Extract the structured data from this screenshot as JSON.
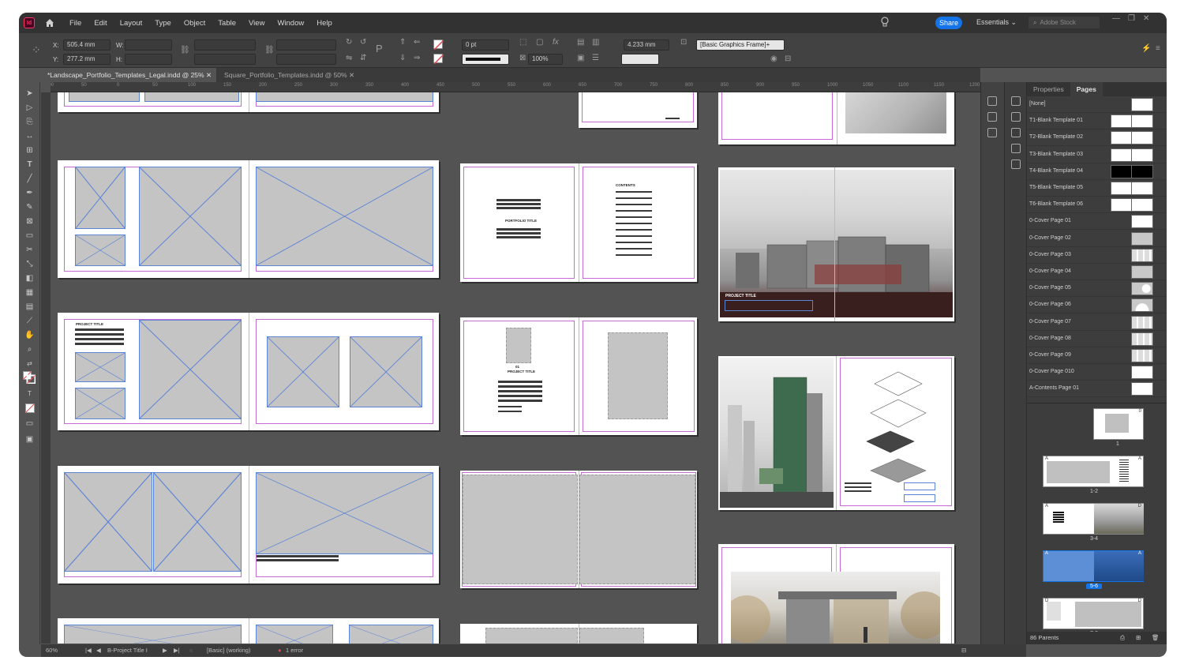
{
  "menu": {
    "items": [
      "File",
      "Edit",
      "Layout",
      "Type",
      "Object",
      "Table",
      "View",
      "Window",
      "Help"
    ],
    "share": "Share",
    "workspace": "Essentials",
    "stock_placeholder": "Adobe Stock"
  },
  "control": {
    "x_label": "X:",
    "x_value": "505.4 mm",
    "y_label": "Y:",
    "y_value": "277.2 mm",
    "w_label": "W:",
    "h_label": "H:",
    "stroke_weight": "0 pt",
    "opacity": "100%",
    "gutter": "4.233 mm",
    "object_style": "[Basic Graphics Frame]+"
  },
  "tabs": {
    "active": "*Landscape_Portfolio_Templates_Legal.indd @ 25%",
    "inactive": "Square_Portfolio_Templates.indd @ 50%"
  },
  "ruler_ticks": [
    "100",
    "50",
    "0",
    "50",
    "100",
    "150",
    "200",
    "250",
    "300",
    "350",
    "400",
    "450",
    "500",
    "550",
    "600",
    "650",
    "700",
    "750",
    "800",
    "850",
    "900",
    "950",
    "1000",
    "1050",
    "1100",
    "1150",
    "1200"
  ],
  "canvas": {
    "portfolio_title": "PORTFOLIO TITLE",
    "contents": "CONTENTS",
    "project_title": "PROJECT TITLE",
    "num_01": "01",
    "project_title_b": "PROJECT TITLE"
  },
  "panel": {
    "tab_properties": "Properties",
    "tab_pages": "Pages",
    "parents": [
      {
        "name": "[None]",
        "style": "white"
      },
      {
        "name": "T1-Blank Template 01",
        "style": "white2"
      },
      {
        "name": "T2-Blank Template 02",
        "style": "white2"
      },
      {
        "name": "T3-Blank Template 03",
        "style": "white2"
      },
      {
        "name": "T4-Blank Template 04",
        "style": "black2"
      },
      {
        "name": "T5-Blank Template 05",
        "style": "white2"
      },
      {
        "name": "T6-Blank Template 06",
        "style": "white2"
      },
      {
        "name": "0-Cover Page 01",
        "style": "white"
      },
      {
        "name": "0-Cover Page 02",
        "style": "grey"
      },
      {
        "name": "0-Cover Page 03",
        "style": "grid"
      },
      {
        "name": "0-Cover Page 04",
        "style": "grey"
      },
      {
        "name": "0-Cover Page 05",
        "style": "circle"
      },
      {
        "name": "0-Cover Page 06",
        "style": "arc"
      },
      {
        "name": "0-Cover Page 07",
        "style": "grid"
      },
      {
        "name": "0-Cover Page 08",
        "style": "grid"
      },
      {
        "name": "0-Cover Page 09",
        "style": "grid"
      },
      {
        "name": "0-Cover Page 010",
        "style": "white"
      },
      {
        "name": "A-Contents Page 01",
        "style": "white"
      }
    ],
    "page_labels": [
      "1",
      "1-2",
      "3-4",
      "5-6",
      "7-8"
    ],
    "parent_letter_a": "A",
    "parent_letter_d": "D",
    "parent_letter_o": "0",
    "status": "86 Parents"
  },
  "status": {
    "zoom": "60%",
    "page": "B-Project Title I",
    "preflight_profile": "[Basic] (working)",
    "errors": "1 error"
  },
  "colors": {
    "accent": "#1473e6",
    "margin": "#c86ad6",
    "frame": "#5c84d6",
    "error": "#e34850"
  }
}
